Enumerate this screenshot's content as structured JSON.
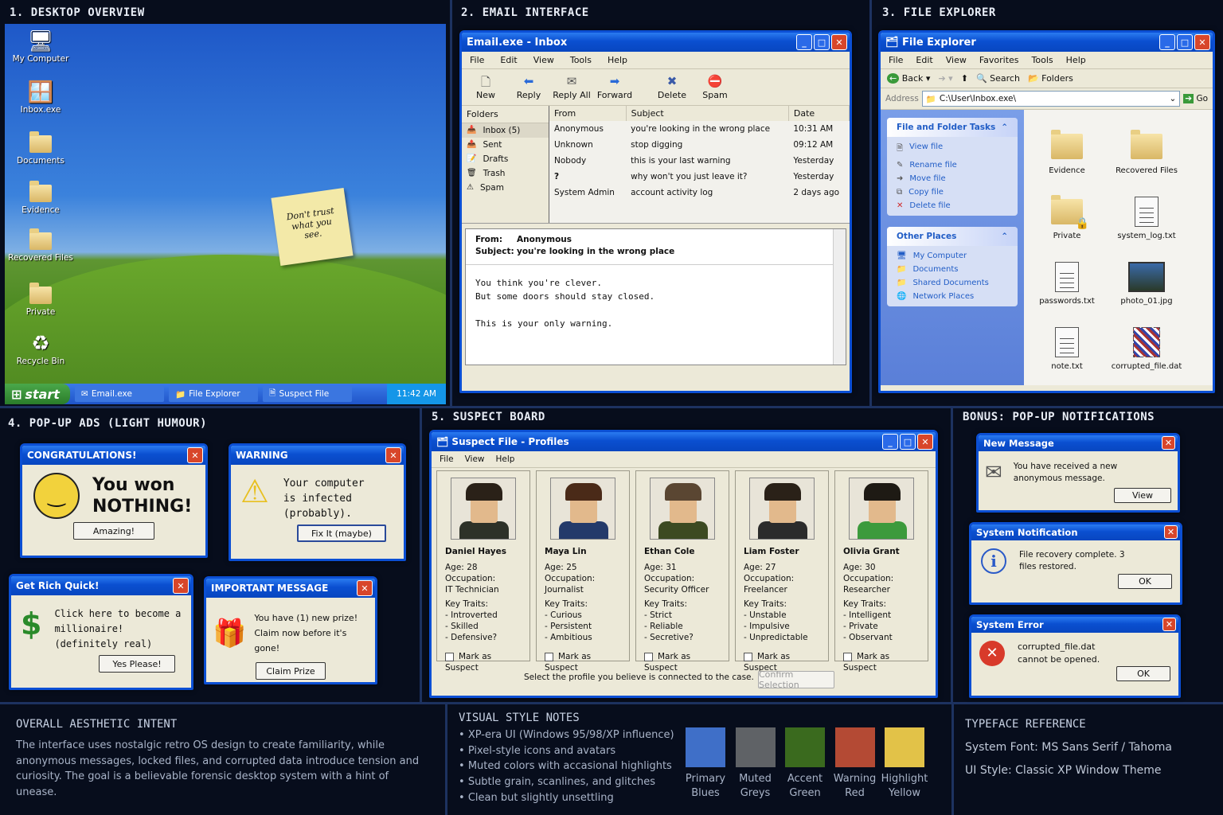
{
  "sections": {
    "desktop": "1. DESKTOP OVERVIEW",
    "email": "2. EMAIL INTERFACE",
    "explorer": "3. FILE EXPLORER",
    "ads": "4. POP-UP ADS (LIGHT HUMOUR)",
    "suspects": "5. SUSPECT BOARD",
    "notifications": "BONUS: POP-UP NOTIFICATIONS"
  },
  "desktop": {
    "icons": [
      "My Computer",
      "Inbox.exe",
      "Documents",
      "Evidence",
      "Recovered Files",
      "Private",
      "Recycle Bin"
    ],
    "sticky_note": "Don't trust what you see.",
    "taskbar": {
      "start": "start",
      "tasks": [
        "Email.exe",
        "File Explorer",
        "Suspect File"
      ],
      "clock": "11:42 AM"
    }
  },
  "email": {
    "title": "Email.exe - Inbox",
    "menu": [
      "File",
      "Edit",
      "View",
      "Tools",
      "Help"
    ],
    "toolbar": [
      {
        "label": "New",
        "icon": "new-icon"
      },
      {
        "label": "Reply",
        "icon": "reply-icon"
      },
      {
        "label": "Reply All",
        "icon": "reply-all-icon"
      },
      {
        "label": "Forward",
        "icon": "forward-icon"
      },
      {
        "label": "Delete",
        "icon": "delete-icon"
      },
      {
        "label": "Spam",
        "icon": "spam-icon"
      }
    ],
    "folders_header": "Folders",
    "folders": [
      "Inbox (5)",
      "Sent",
      "Drafts",
      "Trash",
      "Spam"
    ],
    "columns": [
      "From",
      "Subject",
      "Date"
    ],
    "messages": [
      {
        "from": "Anonymous",
        "subject": "you're looking in the wrong place",
        "date": "10:31 AM"
      },
      {
        "from": "Unknown",
        "subject": "stop digging",
        "date": "09:12 AM"
      },
      {
        "from": "Nobody",
        "subject": "this is your last warning",
        "date": "Yesterday"
      },
      {
        "from": "?",
        "subject": "why won't you just leave it?",
        "date": "Yesterday"
      },
      {
        "from": "System Admin",
        "subject": "account activity log",
        "date": "2 days ago"
      }
    ],
    "preview": {
      "from_label": "From:",
      "from": "Anonymous",
      "subject_label": "Subject:",
      "subject": "you're looking in the wrong place",
      "lines": [
        "You think you're clever.",
        "But some doors should stay closed.",
        "",
        "This is your only warning."
      ]
    }
  },
  "explorer": {
    "title": "File Explorer",
    "menu": [
      "File",
      "Edit",
      "View",
      "Favorites",
      "Tools",
      "Help"
    ],
    "back": "Back",
    "search": "Search",
    "folders": "Folders",
    "address_label": "Address",
    "address": "C:\\User\\Inbox.exe\\",
    "go": "Go",
    "tasks_title": "File and Folder Tasks",
    "tasks": [
      "View file",
      "Rename file",
      "Move file",
      "Copy file",
      "Delete file"
    ],
    "places_title": "Other Places",
    "places": [
      "My Computer",
      "Documents",
      "Shared Documents",
      "Network Places"
    ],
    "files": [
      {
        "name": "Evidence",
        "type": "folder"
      },
      {
        "name": "Recovered Files",
        "type": "folder"
      },
      {
        "name": "Private",
        "type": "locked-folder"
      },
      {
        "name": "system_log.txt",
        "type": "text"
      },
      {
        "name": "passwords.txt",
        "type": "text"
      },
      {
        "name": "photo_01.jpg",
        "type": "image"
      },
      {
        "name": "note.txt",
        "type": "text"
      },
      {
        "name": "corrupted_file.dat",
        "type": "corrupted"
      }
    ]
  },
  "ads": {
    "congrats": {
      "title": "CONGRATULATIONS!",
      "line1": "You won",
      "line2": "NOTHING!",
      "button": "Amazing!"
    },
    "warning": {
      "title": "WARNING",
      "text": "Your computer is infected (probably).",
      "button": "Fix It (maybe)"
    },
    "rich": {
      "title": "Get Rich Quick!",
      "text": "Click here to become a millionaire! (definitely real)",
      "button": "Yes Please!"
    },
    "important": {
      "title": "IMPORTANT MESSAGE",
      "line1": "You have (1) new prize!",
      "line2": "Claim now before it's gone!",
      "button": "Claim Prize"
    }
  },
  "suspects": {
    "title": "Suspect File - Profiles",
    "menu": [
      "File",
      "View",
      "Help"
    ],
    "age_label": "Age:",
    "occupation_label": "Occupation:",
    "traits_label": "Key Traits:",
    "mark_label": "Mark as Suspect",
    "profiles": [
      {
        "name": "Daniel Hayes",
        "age": "28",
        "occupation": "IT Technician",
        "traits": [
          "- Introverted",
          "- Skilled",
          "- Defensive?"
        ],
        "hair": "#2a2118",
        "shirt": "#2d3128"
      },
      {
        "name": "Maya Lin",
        "age": "25",
        "occupation": "Journalist",
        "traits": [
          "- Curious",
          "- Persistent",
          "- Ambitious"
        ],
        "hair": "#4a2a18",
        "shirt": "#243a6a"
      },
      {
        "name": "Ethan Cole",
        "age": "31",
        "occupation": "Security Officer",
        "traits": [
          "- Strict",
          "- Reliable",
          "- Secretive?"
        ],
        "hair": "#5a4632",
        "shirt": "#3c4a22"
      },
      {
        "name": "Liam Foster",
        "age": "27",
        "occupation": "Freelancer",
        "traits": [
          "- Unstable",
          "- Impulsive",
          "- Unpredictable"
        ],
        "hair": "#2a2118",
        "shirt": "#2b2b2b"
      },
      {
        "name": "Olivia Grant",
        "age": "30",
        "occupation": "Researcher",
        "traits": [
          "- Intelligent",
          "- Private",
          "- Observant"
        ],
        "hair": "#1e1a14",
        "shirt": "#3c9a3c"
      }
    ],
    "instruction": "Select the profile you believe is connected to the case.",
    "confirm": "Confirm Selection"
  },
  "notifications": {
    "message": {
      "title": "New Message",
      "text": "You have received a new anonymous message.",
      "button": "View"
    },
    "system": {
      "title": "System Notification",
      "text": "File recovery complete. 3 files restored.",
      "button": "OK"
    },
    "error": {
      "title": "System Error",
      "text": "corrupted_file.dat cannot be opened.",
      "button": "OK"
    }
  },
  "footer": {
    "intent_title": "OVERALL AESTHETIC INTENT",
    "intent_text": "The interface uses nostalgic retro OS design to create familiarity, while anonymous messages, locked files, and corrupted data introduce tension and curiosity. The goal is a believable forensic desktop system with a hint of unease.",
    "style_title": "VISUAL STYLE NOTES",
    "style_notes": [
      "XP-era UI (Windows 95/98/XP influence)",
      "Pixel-style icons and avatars",
      "Muted colors with accasional highlights",
      "Subtle grain, scanlines, and glitches",
      "Clean but slightly unsettling"
    ],
    "palette": [
      {
        "label": "Primary Blues",
        "color": "#3f6fc8"
      },
      {
        "label": "Muted Greys",
        "color": "#5f6266"
      },
      {
        "label": "Accent Green",
        "color": "#3a6a1e"
      },
      {
        "label": "Warning Red",
        "color": "#b44a34"
      },
      {
        "label": "Highlight Yellow",
        "color": "#e2c248"
      }
    ],
    "type_title": "TYPEFACE REFERENCE",
    "system_font": "System Font:  MS Sans Serif / Tahoma",
    "ui_style": "UI Style:  Classic XP Window Theme"
  }
}
